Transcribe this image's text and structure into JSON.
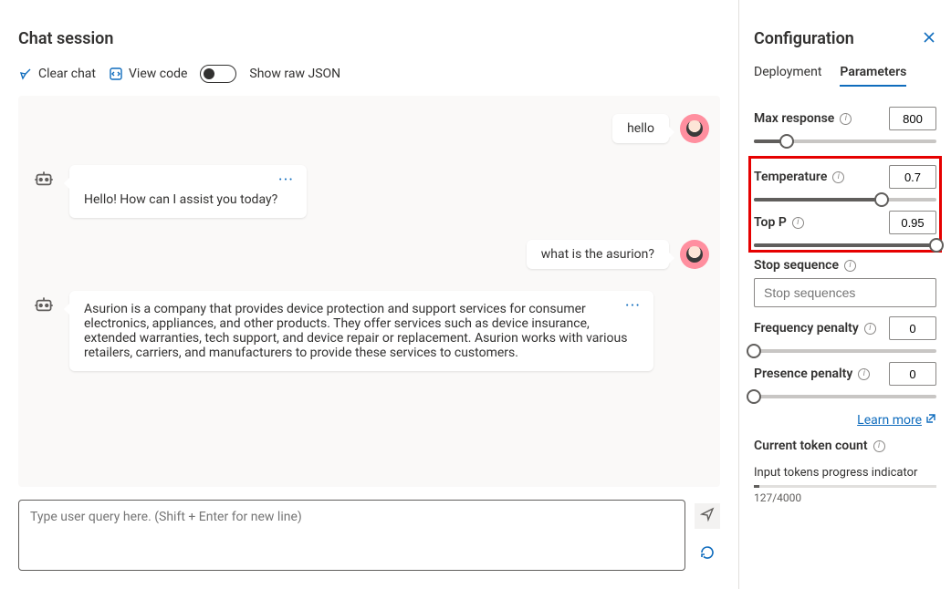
{
  "chat": {
    "title": "Chat session",
    "toolbar": {
      "clear_label": "Clear chat",
      "view_code_label": "View code",
      "show_raw_label": "Show raw JSON"
    },
    "messages": {
      "m0": "hello",
      "m1": "Hello! How can I assist you today?",
      "m2": "what is the asurion?",
      "m3": "Asurion is a company that provides device protection and support services for consumer electronics, appliances, and other products. They offer services such as device insurance, extended warranties, tech support, and device repair or replacement. Asurion works with various retailers, carriers, and manufacturers to provide these services to customers."
    },
    "input_placeholder": "Type user query here. (Shift + Enter for new line)"
  },
  "config": {
    "title": "Configuration",
    "tabs": {
      "deployment": "Deployment",
      "parameters": "Parameters"
    },
    "params": {
      "max_response": {
        "label": "Max response",
        "value": "800",
        "fill_pct": 18
      },
      "temperature": {
        "label": "Temperature",
        "value": "0.7",
        "fill_pct": 70
      },
      "top_p": {
        "label": "Top P",
        "value": "0.95",
        "fill_pct": 100
      },
      "stop": {
        "label": "Stop sequence",
        "placeholder": "Stop sequences"
      },
      "freq": {
        "label": "Frequency penalty",
        "value": "0",
        "fill_pct": 0
      },
      "presence": {
        "label": "Presence penalty",
        "value": "0",
        "fill_pct": 0
      }
    },
    "learn_more": "Learn more",
    "token": {
      "label": "Current token count",
      "sub": "Input tokens progress indicator",
      "count": "127/4000",
      "fill_pct": 3
    }
  }
}
